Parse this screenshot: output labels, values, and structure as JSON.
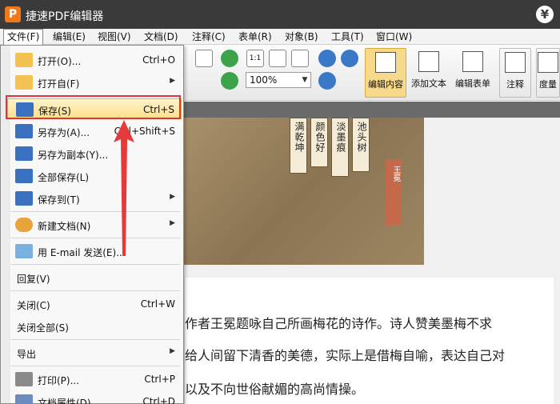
{
  "window": {
    "title": "捷速PDF编辑器",
    "logo_letter": "P",
    "badge_symbol": "¥"
  },
  "menubar": [
    "文件(F)",
    "编辑(E)",
    "视图(V)",
    "文档(D)",
    "注释(C)",
    "表单(R)",
    "对象(B)",
    "工具(T)",
    "窗口(W)"
  ],
  "toolbar": {
    "zoom_ratio_label": "1:1",
    "zoom_value": "100%",
    "buttons": [
      "编辑内容",
      "添加文本",
      "编辑表单",
      "注释",
      "度量"
    ]
  },
  "file_menu": {
    "open": {
      "label": "打开(O)...",
      "shortcut": "Ctrl+O"
    },
    "open_from": {
      "label": "打开自(F)"
    },
    "save": {
      "label": "保存(S)",
      "shortcut": "Ctrl+S"
    },
    "save_as": {
      "label": "另存为(A)...",
      "shortcut": "Ctrl+Shift+S"
    },
    "save_copy": {
      "label": "另存为副本(Y)..."
    },
    "save_all": {
      "label": "全部保存(L)"
    },
    "save_to": {
      "label": "保存到(T)"
    },
    "new_doc": {
      "label": "新建文档(N)"
    },
    "email": {
      "label": "用 E-mail 发送(E)..."
    },
    "revert": {
      "label": "回复(V)"
    },
    "close": {
      "label": "关闭(C)",
      "shortcut": "Ctrl+W"
    },
    "close_all": {
      "label": "关闭全部(S)"
    },
    "export": {
      "label": "导出"
    },
    "print": {
      "label": "打印(P)...",
      "shortcut": "Ctrl+P"
    },
    "properties": {
      "label": "文档属性(D)...",
      "shortcut": "Ctrl+D"
    }
  },
  "painting": {
    "scrolls": [
      "满乾坤",
      "颜色好",
      "淡墨痕",
      "池头树"
    ],
    "seal": "王冕"
  },
  "document": {
    "lines": [
      "作者王冕题咏自己所画梅花的诗作。诗人赞美墨梅不求",
      "给人间留下清香的美德，实际上是借梅自喻，表达自己对",
      "以及不向世俗献媚的高尚情操。"
    ]
  }
}
